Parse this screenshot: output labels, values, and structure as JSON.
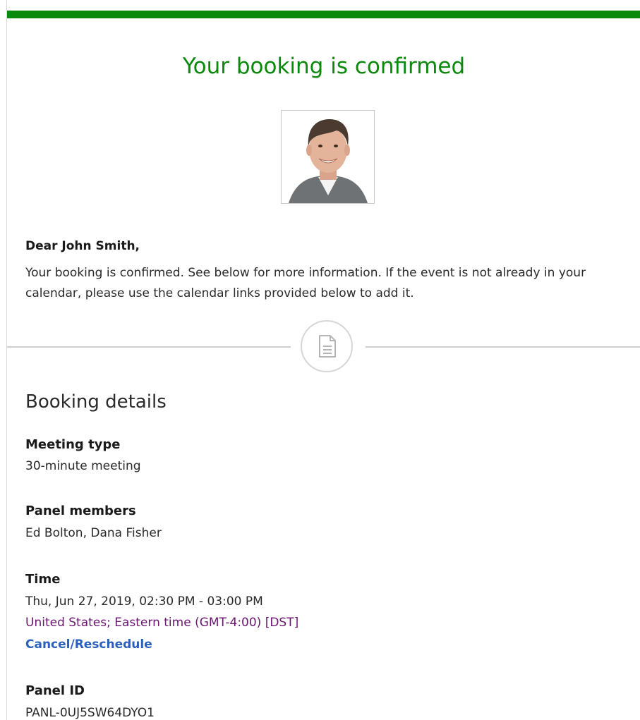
{
  "header": {
    "title": "Your booking is confirmed"
  },
  "avatar": {
    "icon": "person-photo"
  },
  "message": {
    "greeting": "Dear John Smith,",
    "body": "Your booking is confirmed. See below for more information. If the event is not already in your calendar, please use the calendar links provided below to add it."
  },
  "divider": {
    "icon": "document-icon"
  },
  "details": {
    "section_title": "Booking details",
    "meeting_type_label": "Meeting type",
    "meeting_type_value": "30-minute meeting",
    "panel_members_label": "Panel members",
    "panel_members_value": "Ed Bolton, Dana Fisher",
    "time_label": "Time",
    "time_value": "Thu, Jun 27, 2019, 02:30 PM - 03:00 PM",
    "timezone": "United States; Eastern time (GMT-4:00) [DST]",
    "cancel_link": "Cancel/Reschedule",
    "panel_id_label": "Panel ID",
    "panel_id_value": "PANL-0UJ5SW64DYO1"
  },
  "colors": {
    "accent_green": "#0a8a0a",
    "link_blue": "#2b5fbe",
    "timezone_purple": "#6b1670"
  }
}
